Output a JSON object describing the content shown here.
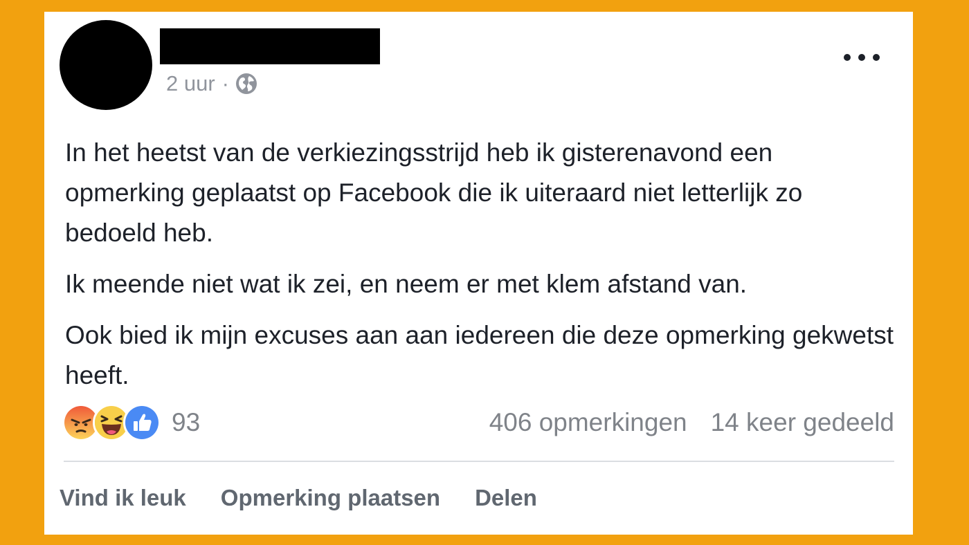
{
  "post": {
    "timestamp": "2 uur",
    "separator": "·",
    "privacy_icon": "globe-icon",
    "paragraphs": [
      "In het heetst van de verkiezingsstrijd heb ik gisterenavond een opmerking geplaatst op Facebook die ik uiteraard niet letterlijk zo bedoeld heb.",
      "Ik meende niet wat ik zei, en neem er met klem afstand van.",
      "Ook bied ik mijn excuses aan aan iedereen die deze opmerking gekwetst heeft."
    ]
  },
  "stats": {
    "reaction_icons": [
      "angry-icon",
      "haha-icon",
      "like-icon"
    ],
    "reaction_count": "93",
    "comments": "406 opmerkingen",
    "shares": "14 keer gedeeld"
  },
  "actions": {
    "like": "Vind ik leuk",
    "comment": "Opmerking plaatsen",
    "share": "Delen"
  },
  "colors": {
    "frame": "#F2A10F",
    "card": "#FFFFFF",
    "text": "#1D2129",
    "muted": "#90949C",
    "like_blue": "#4A8AF4"
  }
}
